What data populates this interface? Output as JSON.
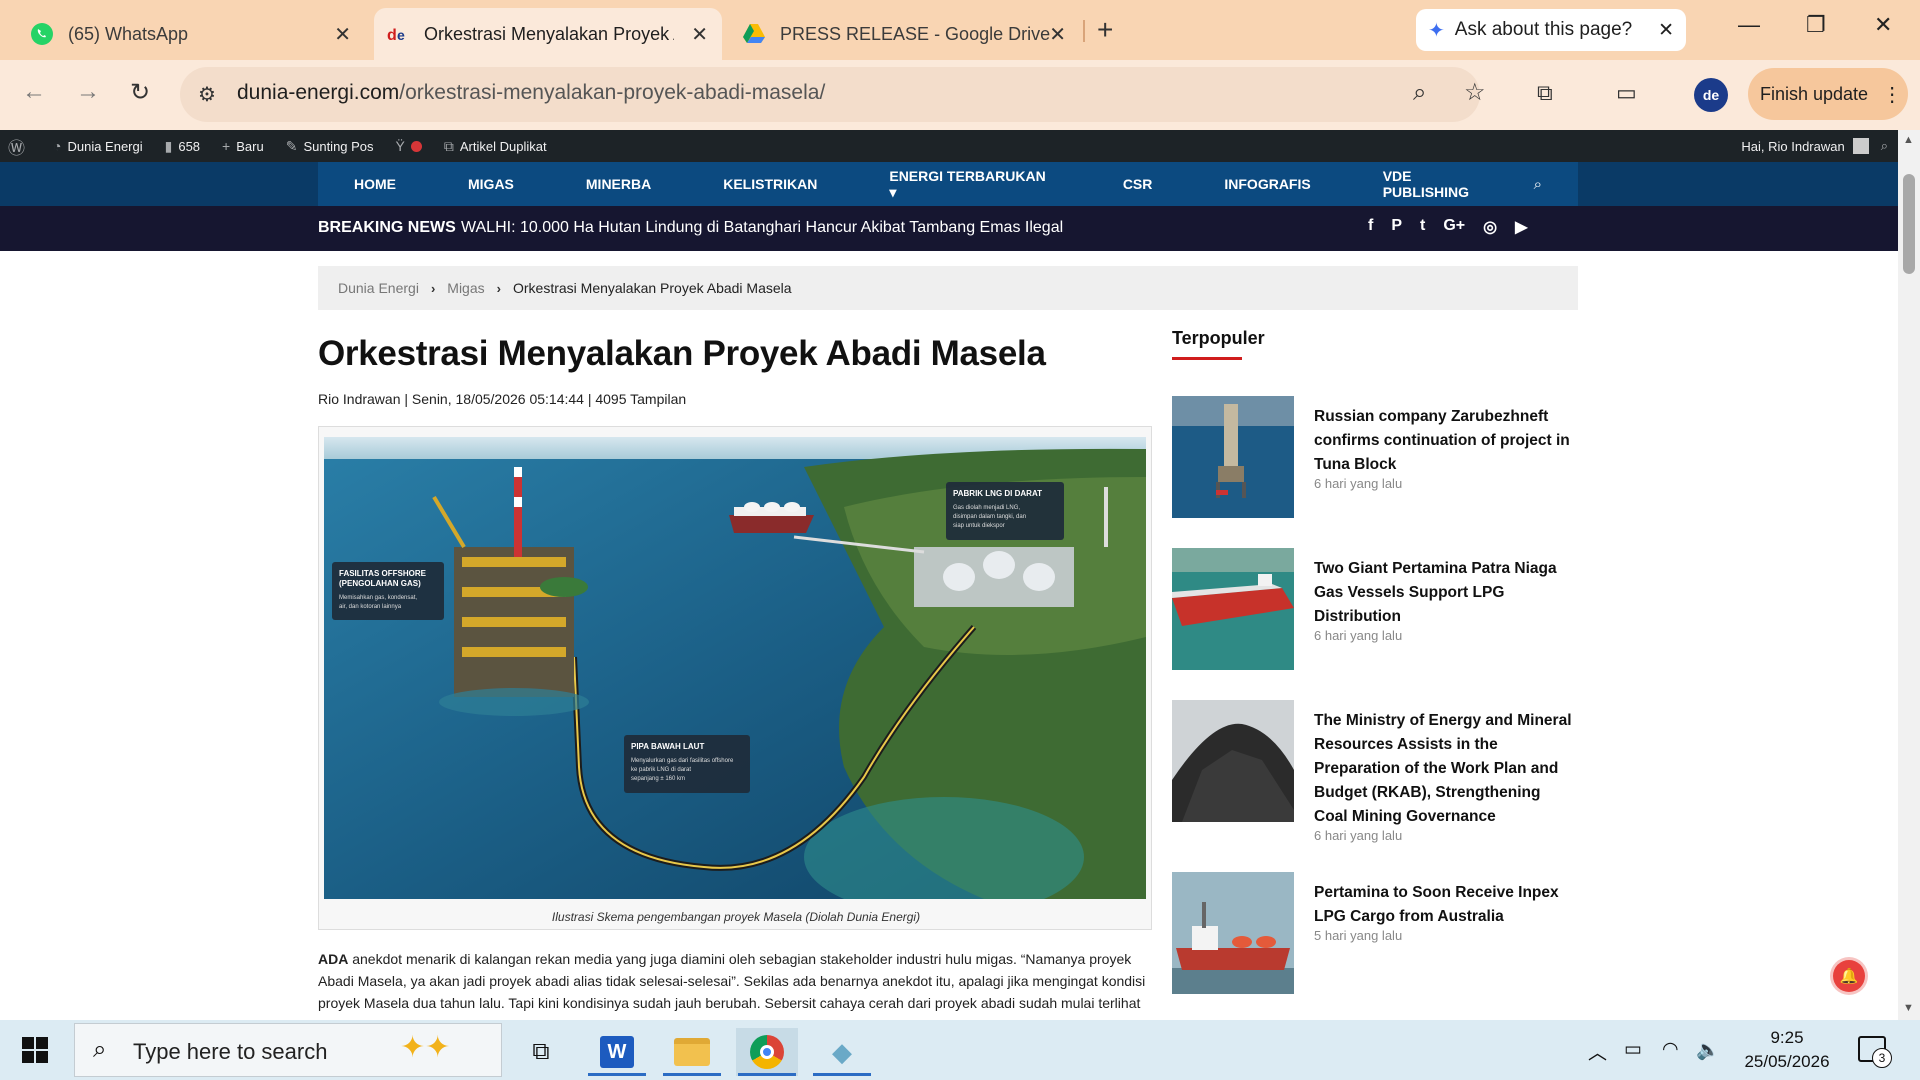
{
  "browser": {
    "tabs": [
      {
        "title": "(65) WhatsApp",
        "icon": "whatsapp-icon"
      },
      {
        "title": "Orkestrasi Menyalakan Proyek A",
        "icon": "dunia-energi-favicon",
        "active": true
      },
      {
        "title": "PRESS RELEASE - Google Drive",
        "icon": "google-drive-icon"
      }
    ],
    "ask_label": "Ask about this page?",
    "url_domain": "dunia-energi.com",
    "url_path": "/orkestrasi-menyalakan-proyek-abadi-masela/",
    "finish_update": "Finish update"
  },
  "wp_admin_bar": {
    "site_name": "Dunia Energi",
    "comments": "658",
    "new": "Baru",
    "edit": "Sunting Pos",
    "duplicate": "Artikel Duplikat",
    "greeting": "Hai, Rio Indrawan"
  },
  "nav": {
    "items": [
      "HOME",
      "MIGAS",
      "MINERBA",
      "KELISTRIKAN",
      "ENERGI TERBARUKAN ▾",
      "CSR",
      "INFOGRAFIS",
      "VDE PUBLISHING"
    ]
  },
  "breaking": {
    "label": "BREAKING NEWS",
    "text": "WALHI: 10.000 Ha Hutan Lindung di Batanghari Hancur Akibat Tambang Emas Ilegal",
    "social": [
      "f",
      "P",
      "t",
      "G+",
      "◎",
      "▶"
    ]
  },
  "breadcrumb": {
    "home": "Dunia Energi",
    "category": "Migas",
    "current": "Orkestrasi Menyalakan Proyek Abadi Masela"
  },
  "article": {
    "title": "Orkestrasi Menyalakan Proyek Abadi Masela",
    "meta": "Rio Indrawan | Senin, 18/05/2026 05:14:44 | 4095 Tampilan",
    "image_labels": {
      "offshore_title": "FASILITAS OFFSHORE (PENGOLAHAN GAS)",
      "offshore_desc": "Memisahkan gas, kondensat, air, dan kotoran lainnya",
      "lng_title": "PABRIK LNG DI DARAT",
      "lng_desc": "Gas diolah menjadi LNG, disimpan dalam tangki, dan siap untuk diekspor",
      "pipe_title": "PIPA BAWAH LAUT",
      "pipe_desc": "Menyalurkan gas dari fasilitas offshore ke pabrik LNG di darat sepanjang ± 160 km"
    },
    "caption": "Ilustrasi Skema pengembangan proyek Masela (Diolah Dunia Energi)",
    "lead_word": "ADA",
    "body": " anekdot menarik di kalangan rekan media yang juga diamini oleh sebagian stakeholder industri hulu migas. “Namanya proyek Abadi Masela, ya akan jadi proyek abadi alias tidak selesai-selesai”. Sekilas ada benarnya anekdot itu, apalagi jika mengingat kondisi proyek Masela dua tahun lalu. Tapi kini kondisinya sudah jauh berubah. Sebersit cahaya cerah dari proyek abadi sudah mulai terlihat"
  },
  "sidebar": {
    "title": "Terpopuler",
    "items": [
      {
        "title": "Russian company Zarubezhneft confirms continuation of project in Tuna Block",
        "ago": "6 hari yang lalu"
      },
      {
        "title": "Two Giant Pertamina Patra Niaga Gas Vessels Support LPG Distribution",
        "ago": "6 hari yang lalu"
      },
      {
        "title": "The Ministry of Energy and Mineral Resources Assists in the Preparation of the Work Plan and Budget (RKAB), Strengthening Coal Mining Governance",
        "ago": "6 hari yang lalu"
      },
      {
        "title": "Pertamina to Soon Receive Inpex LPG Cargo from Australia",
        "ago": "5 hari yang lalu"
      }
    ]
  },
  "taskbar": {
    "search_placeholder": "Type here to search",
    "time": "9:25",
    "date": "25/05/2026",
    "notifications": "3"
  },
  "colors": {
    "tabbar": "#f9d5b3",
    "nav": "#0c4a80",
    "breaking": "#161630",
    "accent_red": "#d01d1d"
  }
}
